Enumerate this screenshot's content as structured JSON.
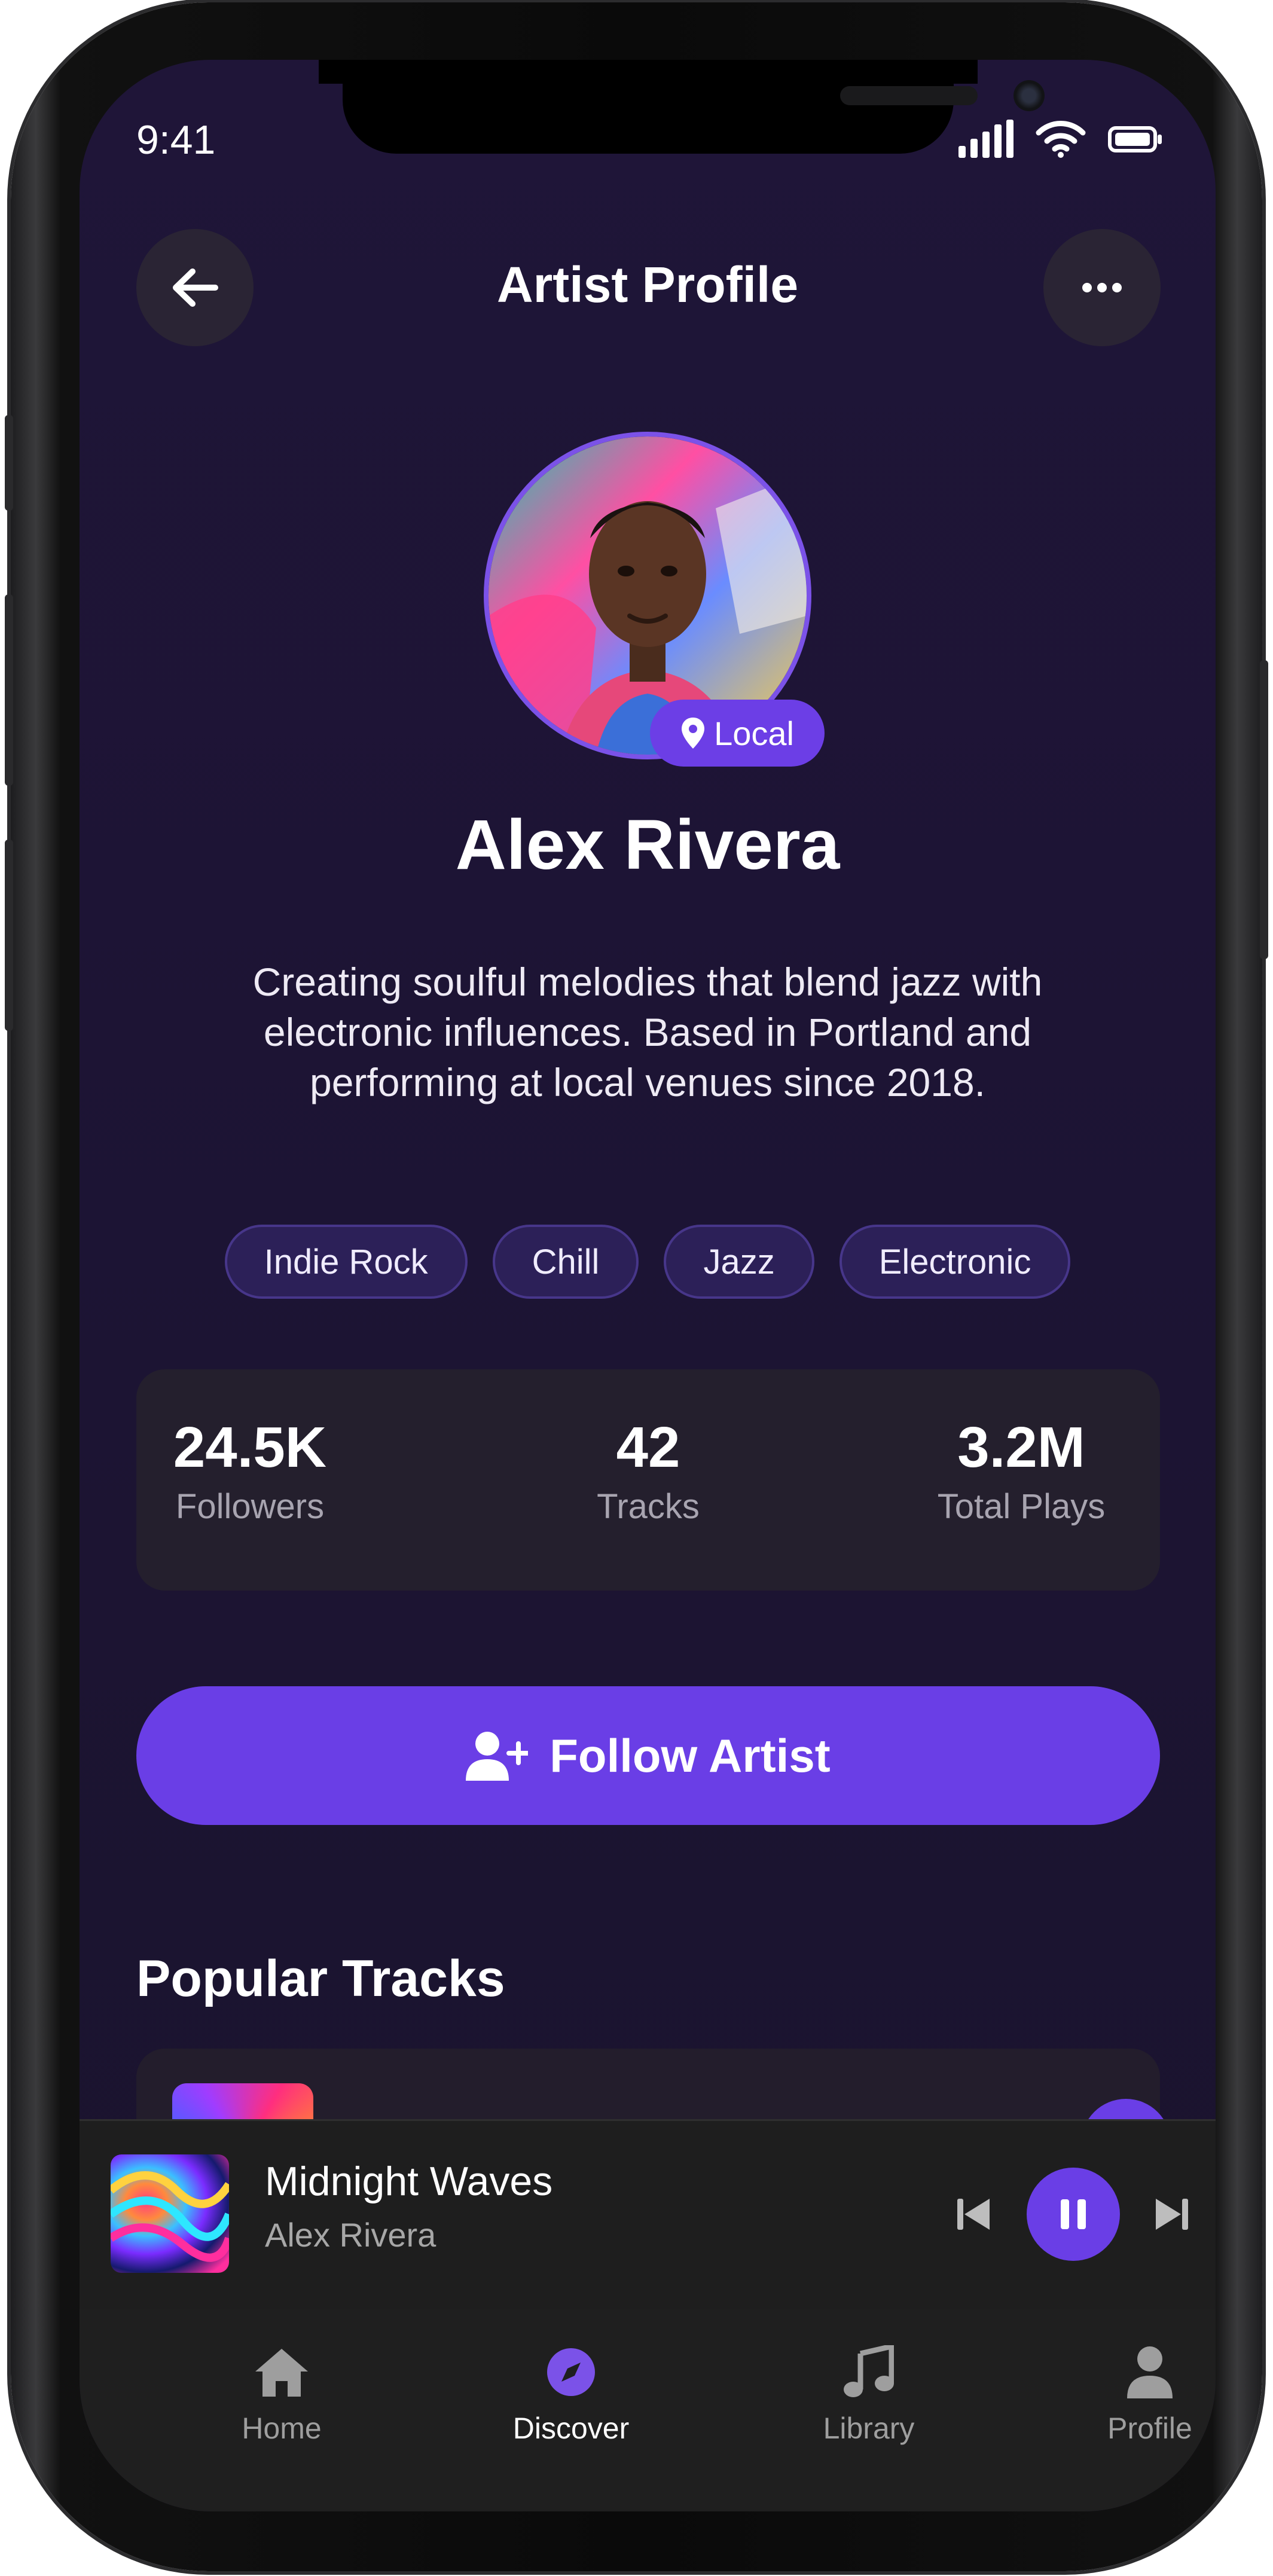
{
  "status_bar": {
    "time": "9:41"
  },
  "header": {
    "title": "Artist Profile"
  },
  "artist": {
    "badge": "Local",
    "name": "Alex Rivera",
    "bio": "Creating soulful melodies that blend jazz with electronic influences. Based in Portland and performing at local venues since 2018.",
    "tags": [
      "Indie Rock",
      "Chill",
      "Jazz",
      "Electronic"
    ]
  },
  "stats": [
    {
      "value": "24.5K",
      "label": "Followers"
    },
    {
      "value": "42",
      "label": "Tracks"
    },
    {
      "value": "3.2M",
      "label": "Total Plays"
    }
  ],
  "follow_button": {
    "label": "Follow Artist"
  },
  "popular_tracks": {
    "title": "Popular Tracks"
  },
  "now_playing": {
    "title": "Midnight Waves",
    "artist": "Alex Rivera"
  },
  "tabs": [
    {
      "label": "Home",
      "icon": "home-icon"
    },
    {
      "label": "Discover",
      "icon": "compass-icon",
      "active": true
    },
    {
      "label": "Library",
      "icon": "music-note-icon"
    },
    {
      "label": "Profile",
      "icon": "user-icon"
    }
  ],
  "colors": {
    "accent": "#6a3ee6",
    "background": "#1f1538",
    "card": "#241f2d"
  }
}
